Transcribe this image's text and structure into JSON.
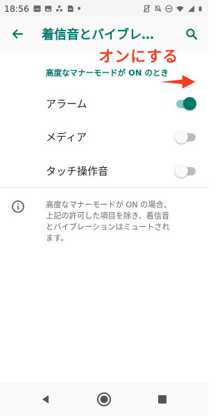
{
  "status_bar": {
    "time": "18:56",
    "icons": [
      "line-app-icon",
      "image-icon",
      "app-icon",
      "file-icon",
      "dot-icon",
      "mute-icon",
      "alarm-off-icon",
      "do-not-disturb-icon",
      "wifi-icon",
      "signal-icon",
      "battery-icon"
    ]
  },
  "app_bar": {
    "title": "着信音とバイブレ…",
    "back_icon": "arrow-back-icon",
    "search_icon": "search-icon"
  },
  "annotation": {
    "text": "オンにする",
    "color": "#ff3b1f"
  },
  "section": {
    "header": "高度なマナーモードが ON のとき"
  },
  "settings": [
    {
      "label": "アラーム",
      "enabled": true
    },
    {
      "label": "メディア",
      "enabled": false
    },
    {
      "label": "タッチ操作音",
      "enabled": false
    }
  ],
  "info": {
    "icon": "info-icon",
    "text": "高度なマナーモードが ON の場合、\n上記の許可した項目を除き、着信音\nとバイブレーションはミュートされ\nます。"
  },
  "nav_bar": {
    "back": "nav-back-icon",
    "home": "nav-home-icon",
    "recents": "nav-recents-icon"
  },
  "colors": {
    "accent": "#00796b",
    "switch_track_on": "#80cbc4"
  }
}
